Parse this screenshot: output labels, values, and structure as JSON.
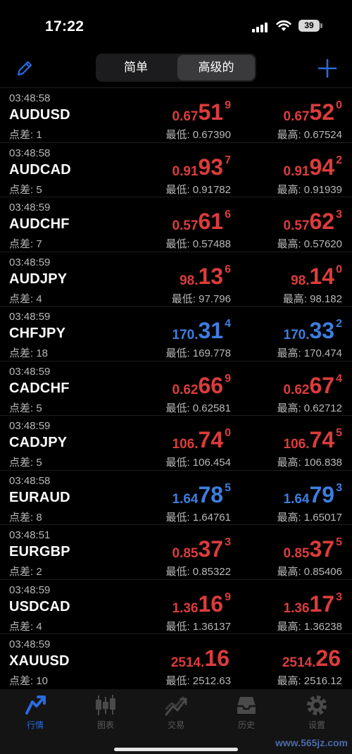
{
  "status": {
    "time": "17:22",
    "battery": "39"
  },
  "toolbar": {
    "segments": [
      "简单",
      "高级的"
    ],
    "active_segment": 1
  },
  "quotes": [
    {
      "time": "03:48:58",
      "symbol": "AUDUSD",
      "spread": "点差: 1",
      "bid": {
        "small": "0.67",
        "big": "51",
        "sup": "9"
      },
      "ask": {
        "small": "0.67",
        "big": "52",
        "sup": "0"
      },
      "direction": "up",
      "low": "最低: 0.67390",
      "high": "最高: 0.67524"
    },
    {
      "time": "03:48:58",
      "symbol": "AUDCAD",
      "spread": "点差: 5",
      "bid": {
        "small": "0.91",
        "big": "93",
        "sup": "7"
      },
      "ask": {
        "small": "0.91",
        "big": "94",
        "sup": "2"
      },
      "direction": "up",
      "low": "最低: 0.91782",
      "high": "最高: 0.91939"
    },
    {
      "time": "03:48:59",
      "symbol": "AUDCHF",
      "spread": "点差: 7",
      "bid": {
        "small": "0.57",
        "big": "61",
        "sup": "6"
      },
      "ask": {
        "small": "0.57",
        "big": "62",
        "sup": "3"
      },
      "direction": "up",
      "low": "最低: 0.57488",
      "high": "最高: 0.57620"
    },
    {
      "time": "03:48:59",
      "symbol": "AUDJPY",
      "spread": "点差: 4",
      "bid": {
        "small": "98.",
        "big": "13",
        "sup": "6"
      },
      "ask": {
        "small": "98.",
        "big": "14",
        "sup": "0"
      },
      "direction": "up",
      "low": "最低: 97.796",
      "high": "最高: 98.182"
    },
    {
      "time": "03:48:59",
      "symbol": "CHFJPY",
      "spread": "点差: 18",
      "bid": {
        "small": "170.",
        "big": "31",
        "sup": "4"
      },
      "ask": {
        "small": "170.",
        "big": "33",
        "sup": "2"
      },
      "direction": "down",
      "low": "最低: 169.778",
      "high": "最高: 170.474"
    },
    {
      "time": "03:48:59",
      "symbol": "CADCHF",
      "spread": "点差: 5",
      "bid": {
        "small": "0.62",
        "big": "66",
        "sup": "9"
      },
      "ask": {
        "small": "0.62",
        "big": "67",
        "sup": "4"
      },
      "direction": "up",
      "low": "最低: 0.62581",
      "high": "最高: 0.62712"
    },
    {
      "time": "03:48:59",
      "symbol": "CADJPY",
      "spread": "点差: 5",
      "bid": {
        "small": "106.",
        "big": "74",
        "sup": "0"
      },
      "ask": {
        "small": "106.",
        "big": "74",
        "sup": "5"
      },
      "direction": "up",
      "low": "最低: 106.454",
      "high": "最高: 106.838"
    },
    {
      "time": "03:48:58",
      "symbol": "EURAUD",
      "spread": "点差: 8",
      "bid": {
        "small": "1.64",
        "big": "78",
        "sup": "5"
      },
      "ask": {
        "small": "1.64",
        "big": "79",
        "sup": "3"
      },
      "direction": "down",
      "low": "最低: 1.64761",
      "high": "最高: 1.65017"
    },
    {
      "time": "03:48:51",
      "symbol": "EURGBP",
      "spread": "点差: 2",
      "bid": {
        "small": "0.85",
        "big": "37",
        "sup": "3"
      },
      "ask": {
        "small": "0.85",
        "big": "37",
        "sup": "5"
      },
      "direction": "up",
      "low": "最低: 0.85322",
      "high": "最高: 0.85406"
    },
    {
      "time": "03:48:59",
      "symbol": "USDCAD",
      "spread": "点差: 4",
      "bid": {
        "small": "1.36",
        "big": "16",
        "sup": "9"
      },
      "ask": {
        "small": "1.36",
        "big": "17",
        "sup": "3"
      },
      "direction": "up",
      "low": "最低: 1.36137",
      "high": "最高: 1.36238"
    },
    {
      "time": "03:48:59",
      "symbol": "XAUUSD",
      "spread": "点差: 10",
      "bid": {
        "small": "2514.",
        "big": "16",
        "sup": ""
      },
      "ask": {
        "small": "2514.",
        "big": "26",
        "sup": ""
      },
      "direction": "up",
      "low": "最低: 2512.63",
      "high": "最高: 2516.12"
    }
  ],
  "tabs": [
    {
      "label": "行情",
      "icon": "quotes-icon"
    },
    {
      "label": "图表",
      "icon": "candlestick-icon"
    },
    {
      "label": "交易",
      "icon": "trade-icon"
    },
    {
      "label": "历史",
      "icon": "history-icon"
    },
    {
      "label": "设置",
      "icon": "settings-icon"
    }
  ],
  "active_tab": 0,
  "watermark": "www.565jz.com",
  "colors": {
    "up": "#dc3c3c",
    "down": "#3d7ee0",
    "accent": "#2a6be0"
  }
}
